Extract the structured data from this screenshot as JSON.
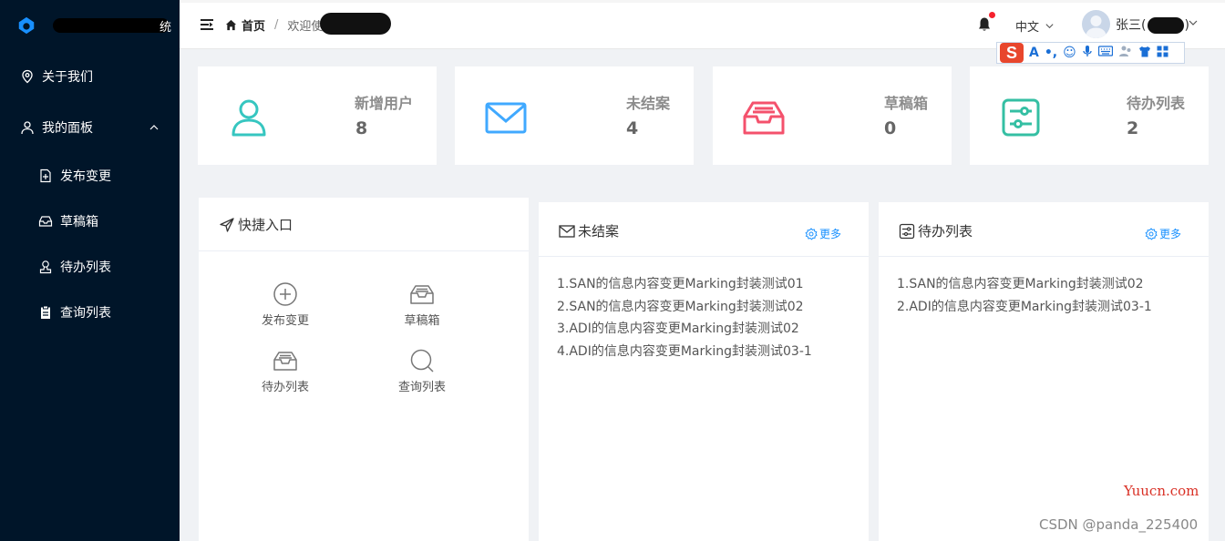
{
  "app": {
    "title": "统"
  },
  "sidebar": {
    "items": [
      {
        "label": "关于我们",
        "icon": "location-icon"
      },
      {
        "label": "我的面板",
        "icon": "user-icon"
      }
    ],
    "subitems": [
      {
        "label": "发布变更",
        "icon": "add-doc-icon"
      },
      {
        "label": "草稿箱",
        "icon": "inbox-icon"
      },
      {
        "label": "待办列表",
        "icon": "person-stamp-icon"
      },
      {
        "label": "查询列表",
        "icon": "clipboard-icon"
      }
    ]
  },
  "header": {
    "breadcrumb": {
      "home": "首页",
      "sep": "/",
      "current": "欢迎使"
    },
    "language": "中文",
    "username": "张三(",
    "username_tail": ")"
  },
  "ime": {
    "logo": "S",
    "icons": [
      "A",
      "•,",
      "☺",
      "🎤",
      "⌨",
      "👥",
      "👕",
      "▦"
    ]
  },
  "stats": [
    {
      "label": "新增用户",
      "value": "8",
      "icon": "user-icon",
      "color": "#36c6c0"
    },
    {
      "label": "未结案",
      "value": "4",
      "icon": "mail-icon",
      "color": "#40a9ff"
    },
    {
      "label": "草稿箱",
      "value": "0",
      "icon": "inbox-icon",
      "color": "#f4516c"
    },
    {
      "label": "待办列表",
      "value": "2",
      "icon": "todo-icon",
      "color": "#34bfa3"
    }
  ],
  "quick": {
    "title": "快捷入口",
    "items": [
      {
        "label": "发布变更",
        "icon": "plus-circle-icon"
      },
      {
        "label": "草稿箱",
        "icon": "inbox-icon"
      },
      {
        "label": "待办列表",
        "icon": "inbox-icon"
      },
      {
        "label": "查询列表",
        "icon": "search-icon"
      }
    ]
  },
  "unclosed": {
    "title": "未结案",
    "more": "更多",
    "items": [
      "1.SAN的信息内容变更Marking封装测试01",
      "2.SAN的信息内容变更Marking封装测试02",
      "3.ADI的信息内容变更Marking封装测试02",
      "4.ADI的信息内容变更Marking封装测试03-1"
    ]
  },
  "todo": {
    "title": "待办列表",
    "more": "更多",
    "items": [
      "1.SAN的信息内容变更Marking封装测试02",
      "2.ADI的信息内容变更Marking封装测试03-1"
    ]
  },
  "watermarks": {
    "site": "Yuucn.com",
    "csdn": "CSDN @panda_225400"
  }
}
